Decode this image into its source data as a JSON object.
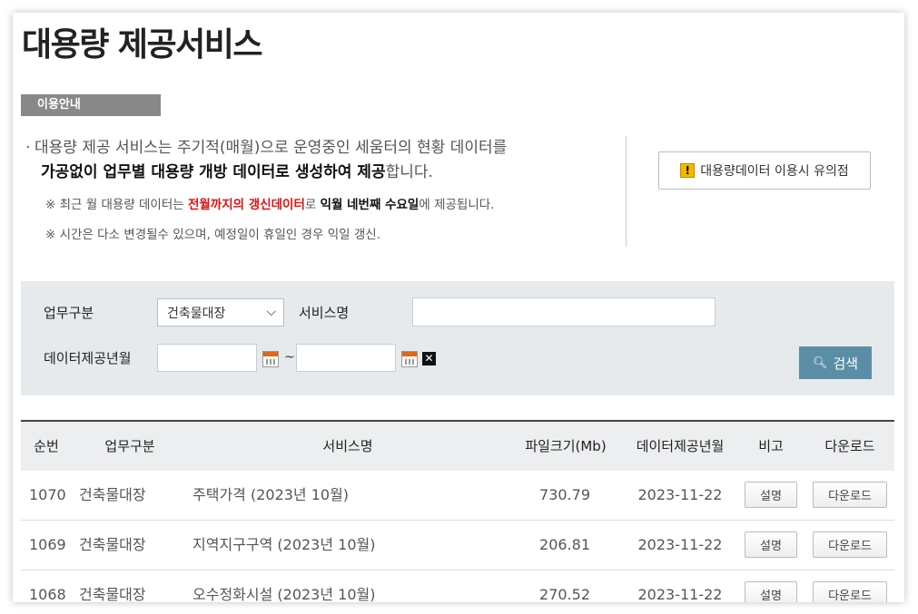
{
  "page_title": "대용량 제공서비스",
  "guide_badge": "이용안내",
  "info": {
    "line1": "대용량 제공 서비스는 주기적(매월)으로 운영중인 세움터의 현황 데이터를",
    "line2_bold": "가공없이 업무별 대용량 개방 데이터로 생성하여 제공",
    "line2_rest": "합니다.",
    "note1_pre": "※ 최근 월 대용량 데이터는 ",
    "note1_red": "전월까지의 갱신데이터",
    "note1_mid": "로 ",
    "note1_bold": "익월 네번째 수요일",
    "note1_post": "에 제공됩니다.",
    "note2": "※ 시간은 다소 변경될수 있으며, 예정일이 휴일인 경우 익일 갱신."
  },
  "notice_button": {
    "label": "대용량데이터 이용시 유의점",
    "icon": "warning-icon"
  },
  "search": {
    "work_type_label": "업무구분",
    "work_type_value": "건축물대장",
    "service_name_label": "서비스명",
    "service_name_value": "",
    "date_label": "데이터제공년월",
    "date_from": "",
    "date_to": "",
    "tilde": "~",
    "clear_glyph": "✕",
    "search_label": "검색"
  },
  "table": {
    "headers": [
      "순번",
      "업무구분",
      "서비스명",
      "파일크기(Mb)",
      "데이터제공년월",
      "비고",
      "다운로드"
    ],
    "rows": [
      {
        "no": "1070",
        "type": "건축물대장",
        "service": "주택가격 (2023년 10월)",
        "size": "730.79",
        "date": "2023-11-22",
        "note": "설명",
        "download": "다운로드"
      },
      {
        "no": "1069",
        "type": "건축물대장",
        "service": "지역지구구역 (2023년 10월)",
        "size": "206.81",
        "date": "2023-11-22",
        "note": "설명",
        "download": "다운로드"
      },
      {
        "no": "1068",
        "type": "건축물대장",
        "service": "오수정화시설 (2023년 10월)",
        "size": "270.52",
        "date": "2023-11-22",
        "note": "설명",
        "download": "다운로드"
      }
    ]
  }
}
